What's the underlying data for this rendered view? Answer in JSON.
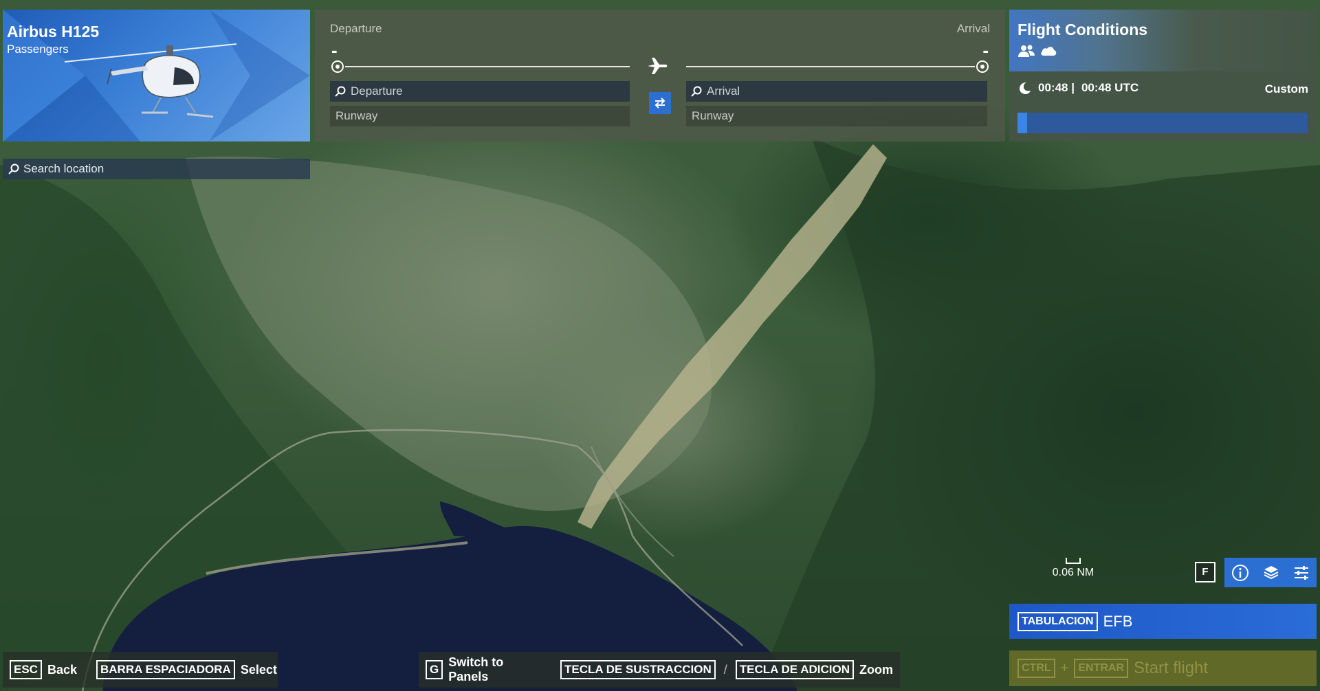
{
  "aircraft": {
    "name": "Airbus H125",
    "subtitle": "Passengers"
  },
  "route": {
    "departure_label": "Departure",
    "arrival_label": "Arrival",
    "departure_code": "-",
    "arrival_code": "-",
    "departure_search_placeholder": "Departure",
    "arrival_search_placeholder": "Arrival",
    "departure_runway_placeholder": "Runway",
    "arrival_runway_placeholder": "Runway",
    "swap_icon": "swap-arrows-icon",
    "route_icon": "airplane-icon"
  },
  "conditions": {
    "title": "Flight Conditions",
    "icons": [
      "passengers-icon",
      "cloud-icon"
    ],
    "time_icon": "moon-icon",
    "local_time": "00:48 |",
    "utc_time": "00:48 UTC",
    "mode": "Custom",
    "time_of_day_fraction": 0.033
  },
  "search": {
    "placeholder": "Search location"
  },
  "map": {
    "scale_label": "0.06 NM",
    "filter_key": "F",
    "tools": [
      "info-icon",
      "layers-icon",
      "settings-sliders-icon"
    ]
  },
  "efb": {
    "key": "TABULACION",
    "label": "EFB"
  },
  "start": {
    "key1": "CTRL",
    "plus": "+",
    "key2": "ENTRAR",
    "label": "Start flight"
  },
  "hints": {
    "back_key": "ESC",
    "back_label": "Back",
    "select_key": "BARRA ESPACIADORA",
    "select_label": "Select",
    "panels_key": "G",
    "panels_label": "Switch to Panels",
    "zoom_out_key": "TECLA DE SUSTRACCION",
    "zoom_sep": "/",
    "zoom_in_key": "TECLA DE ADICION",
    "zoom_label": "Zoom"
  },
  "colors": {
    "accent_blue": "#2b6fd3",
    "start_disabled": "#78782a"
  }
}
